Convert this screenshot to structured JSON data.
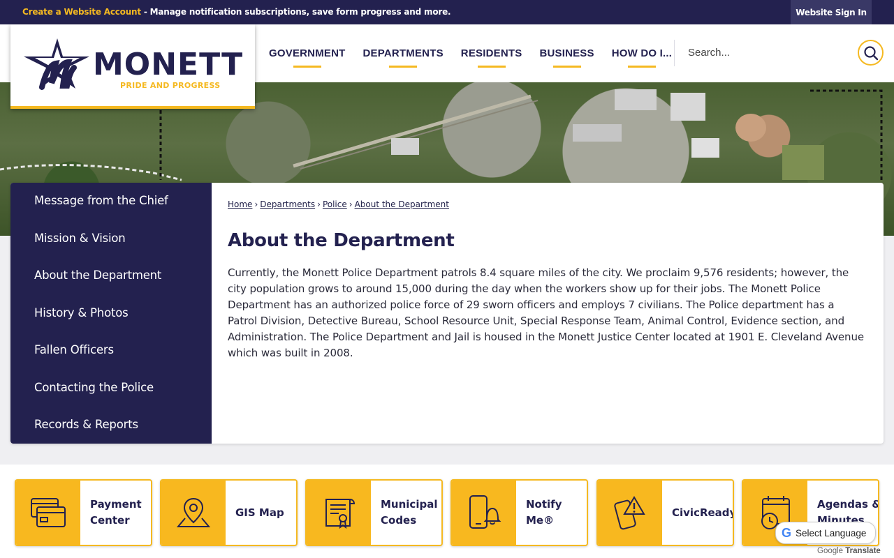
{
  "topbar": {
    "create_link": "Create a Website Account",
    "message": " - Manage notification subscriptions, save form progress and more.",
    "signin": "Website Sign In"
  },
  "logo": {
    "name": "MONETT",
    "tagline": "PRIDE AND PROGRESS"
  },
  "nav": {
    "items": [
      "GOVERNMENT",
      "DEPARTMENTS",
      "RESIDENTS",
      "BUSINESS",
      "HOW DO I..."
    ]
  },
  "search": {
    "placeholder": "Search..."
  },
  "sidebar": {
    "items": [
      "Message from the Chief",
      "Mission & Vision",
      "About the Department",
      "History & Photos",
      "Fallen Officers",
      "Contacting the Police",
      "Records & Reports"
    ]
  },
  "breadcrumb": [
    "Home",
    "Departments",
    "Police",
    "About the Department"
  ],
  "page": {
    "title": "About the Department",
    "body": "Currently, the Monett Police Department patrols 8.4 square miles of the city. We proclaim 9,576 residents; however, the city population grows to around 15,000 during the day when the workers show up for their jobs. The Monett Police Department has an authorized police force of 29 sworn officers and employs 7 civilians. The Police department has a Patrol Division, Detective Bureau, School Resource Unit, Special Response Team, Animal Control, Evidence section, and Administration. The Police Department and Jail is housed in the Monett Justice Center located at 1901 E. Cleveland Avenue which was built in 2008."
  },
  "quicklinks": [
    {
      "label": "Payment Center",
      "icon": "credit-card-icon"
    },
    {
      "label": "GIS Map",
      "icon": "map-pin-icon"
    },
    {
      "label": "Municipal Codes",
      "icon": "scroll-certificate-icon"
    },
    {
      "label": "Notify Me®",
      "icon": "phone-bell-icon"
    },
    {
      "label": "CivicReady®",
      "icon": "phone-alert-icon"
    },
    {
      "label": "Agendas & Minutes",
      "icon": "calendar-clock-icon"
    }
  ],
  "translate": {
    "label": "Select Language",
    "brand_google": "Google",
    "brand_translate": "Translate"
  },
  "colors": {
    "navy": "#23214f",
    "gold": "#f5b921"
  }
}
